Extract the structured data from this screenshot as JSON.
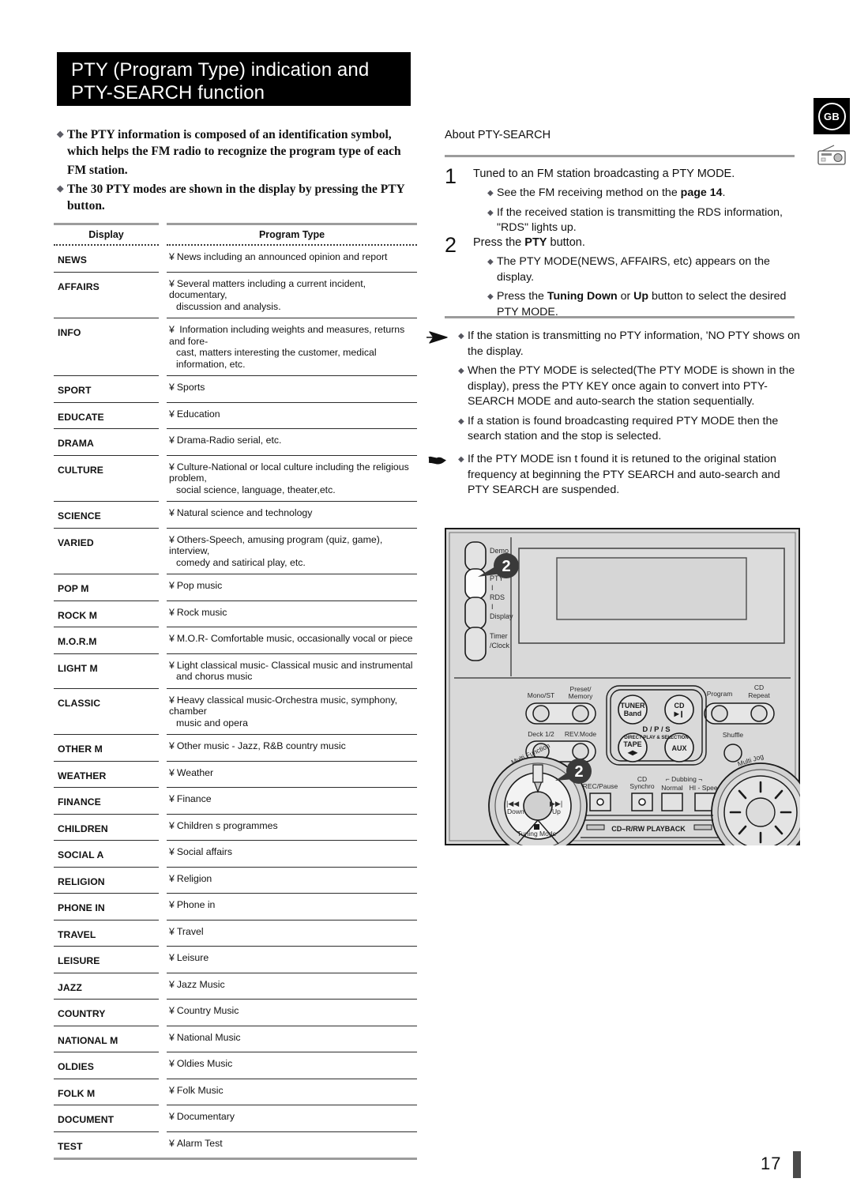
{
  "page": {
    "number": "17",
    "locale_badge": "GB",
    "title_line1": "PTY (Program Type) indication and",
    "title_line2": "PTY-SEARCH function"
  },
  "intro": {
    "bullets": [
      "The PTY information is composed of an identification symbol, which helps the  FM radio to recognize the program type of each",
      "The 30 PTY modes are shown in the display by pressing the PTY button."
    ],
    "bullet1_tail": "FM station."
  },
  "table": {
    "headers": {
      "display": "Display",
      "program_type": "Program Type"
    },
    "bullet_char": "¥",
    "rows": [
      {
        "display": "NEWS",
        "desc1": "News including an announced opinion and report",
        "desc2": ""
      },
      {
        "display": "AFFAIRS",
        "desc1": "Several matters including a current incident, documentary,",
        "desc2": "discussion and analysis."
      },
      {
        "display": "INFO",
        "desc1": " Information including weights and measures, returns and fore-",
        "desc2": "cast, matters interesting the customer, medical information, etc."
      },
      {
        "display": "SPORT",
        "desc1": "Sports",
        "desc2": ""
      },
      {
        "display": "EDUCATE",
        "desc1": "Education",
        "desc2": ""
      },
      {
        "display": "DRAMA",
        "desc1": "Drama-Radio serial, etc.",
        "desc2": ""
      },
      {
        "display": "CULTURE",
        "desc1": "Culture-National or local culture including the religious problem,",
        "desc2": "social science, language, theater,etc."
      },
      {
        "display": "SCIENCE",
        "desc1": "Natural science and technology",
        "desc2": ""
      },
      {
        "display": "VARIED",
        "desc1": "Others-Speech, amusing program (quiz, game), interview,",
        "desc2": "comedy and satirical play, etc."
      },
      {
        "display": "POP M",
        "desc1": "Pop music",
        "desc2": ""
      },
      {
        "display": "ROCK M",
        "desc1": "Rock music",
        "desc2": ""
      },
      {
        "display": "M.O.R.M",
        "desc1": "M.O.R- Comfortable music, occasionally vocal or piece",
        "desc2": ""
      },
      {
        "display": "LIGHT M",
        "desc1": "Light classical music- Classical music and instrumental",
        "desc2": "and chorus music"
      },
      {
        "display": "CLASSIC",
        "desc1": "Heavy classical  music-Orchestra music, symphony, chamber",
        "desc2": "music and opera"
      },
      {
        "display": "OTHER M",
        "desc1": "Other music - Jazz, R&B country music",
        "desc2": ""
      },
      {
        "display": "WEATHER",
        "desc1": "Weather",
        "desc2": ""
      },
      {
        "display": "FINANCE",
        "desc1": "Finance",
        "desc2": ""
      },
      {
        "display": "CHILDREN",
        "desc1": "Children s programmes",
        "desc2": ""
      },
      {
        "display": "SOCIAL  A",
        "desc1": "Social affairs",
        "desc2": ""
      },
      {
        "display": "RELIGION",
        "desc1": "Religion",
        "desc2": ""
      },
      {
        "display": "PHONE IN",
        "desc1": "Phone in",
        "desc2": ""
      },
      {
        "display": "TRAVEL",
        "desc1": "Travel",
        "desc2": ""
      },
      {
        "display": "LEISURE",
        "desc1": "Leisure",
        "desc2": ""
      },
      {
        "display": "JAZZ",
        "desc1": "Jazz Music",
        "desc2": ""
      },
      {
        "display": "COUNTRY",
        "desc1": "Country Music",
        "desc2": ""
      },
      {
        "display": "NATIONAL M",
        "desc1": "National Music",
        "desc2": ""
      },
      {
        "display": "OLDIES",
        "desc1": "Oldies Music",
        "desc2": ""
      },
      {
        "display": "FOLK M",
        "desc1": "Folk Music",
        "desc2": ""
      },
      {
        "display": "DOCUMENT",
        "desc1": "Documentary",
        "desc2": ""
      },
      {
        "display": "TEST",
        "desc1": "Alarm Test",
        "desc2": ""
      }
    ]
  },
  "right": {
    "about_heading": "About PTY-SEARCH",
    "step1": {
      "number": "1",
      "lead": "Tuned to an FM station broadcasting a PTY MODE.",
      "items": [
        {
          "pre": "See the FM  receiving method on the ",
          "bold": "page 14",
          "post": "."
        },
        {
          "pre": "If the received station is transmitting the RDS information, \"RDS\" lights up.",
          "bold": "",
          "post": ""
        }
      ]
    },
    "step2": {
      "number": "2",
      "lead_pre": "Press the ",
      "lead_bold": "PTY",
      "lead_post": " button.",
      "items": [
        {
          "pre": "The PTY MODE(NEWS, AFFAIRS, etc) appears on the display.",
          "bold": "",
          "post": ""
        },
        {
          "pre": "Press the ",
          "bold": "Tuning Down",
          "mid": " or ",
          "bold2": "Up",
          "post": " button to select the desired PTY MODE."
        }
      ]
    },
    "note_a": {
      "symbol": "arrow-note-icon",
      "items": [
        "If the station is transmitting no PTY information, 'NO PTY shows on the display.",
        "When the PTY MODE is selected(The PTY MODE is shown in  the display), press the PTY KEY once again to convert into PTY-SEARCH MODE and auto-search the station sequentially.",
        "If a station is found broadcasting required PTY MODE then the search station and the stop is selected."
      ]
    },
    "note_b": {
      "symbol": "pointing-hand-icon",
      "items": [
        "If the PTY MODE isn t found it is retuned to the original station frequency at beginning the PTY SEARCH and auto-search and PTY SEARCH are suspended."
      ]
    }
  },
  "device": {
    "callout": "2",
    "side_buttons": [
      "Demo",
      "PTY",
      "RDS",
      "Display",
      "Timer",
      "/Clock"
    ],
    "separators": [
      "I",
      "I"
    ],
    "controls_row1": [
      "Mono/ST",
      "Preset/",
      "Memory",
      "Program",
      "CD",
      "Repeat"
    ],
    "controls_row2": [
      "Deck 1/2",
      "REV.Mode",
      "Shuffle"
    ],
    "source_buttons": [
      "TUNER",
      "Band",
      "CD",
      "TAPE",
      "AUX"
    ],
    "dps_label_line1": "D / P / S",
    "dps_label_line2": "DIRECT PLAY & SELECTION",
    "rec_labels": [
      "REC/Pause",
      "CD",
      "Synchro",
      "Dubbing",
      "Normal",
      "HI - Speed"
    ],
    "jog_left_label": "Multi  Function",
    "jog_left_marks": [
      "Down",
      "Up",
      "Tuning Mode"
    ],
    "jog_right_label": "Multi  Jog",
    "cd_tray_label": "CD–R/RW PLAYBACK"
  }
}
